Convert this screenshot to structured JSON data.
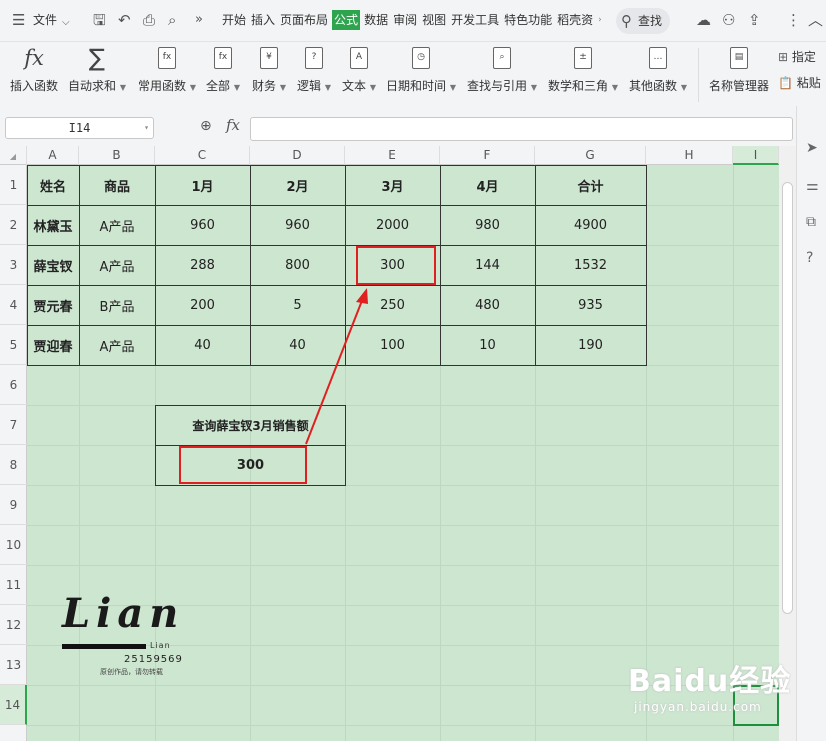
{
  "menubar": {
    "file_label": "文件",
    "tabs": [
      "开始",
      "插入",
      "页面布局",
      "公式",
      "数据",
      "审阅",
      "视图",
      "开发工具",
      "特色功能",
      "稻壳资"
    ],
    "active_tab": "公式",
    "search_label": "查找"
  },
  "ribbon": {
    "buttons": [
      "插入函数",
      "自动求和",
      "常用函数",
      "全部",
      "财务",
      "逻辑",
      "文本",
      "日期和时间",
      "查找与引用",
      "数学和三角",
      "其他函数",
      "名称管理器"
    ],
    "right": [
      "指定",
      "粘贴"
    ]
  },
  "formula_bar": {
    "name_box": "I14",
    "formula": ""
  },
  "columns": [
    "A",
    "B",
    "C",
    "D",
    "E",
    "F",
    "G",
    "H",
    "I"
  ],
  "rows": [
    "1",
    "2",
    "3",
    "4",
    "5",
    "6",
    "7",
    "8",
    "9",
    "10",
    "11",
    "12",
    "13",
    "14"
  ],
  "table": {
    "header": [
      "姓名",
      "商品",
      "1月",
      "2月",
      "3月",
      "4月",
      "合计"
    ],
    "rows": [
      [
        "林黛玉",
        "A产品",
        "960",
        "960",
        "2000",
        "980",
        "4900"
      ],
      [
        "薛宝钗",
        "A产品",
        "288",
        "800",
        "300",
        "144",
        "1532"
      ],
      [
        "贾元春",
        "B产品",
        "200",
        "5",
        "250",
        "480",
        "935"
      ],
      [
        "贾迎春",
        "A产品",
        "40",
        "40",
        "100",
        "10",
        "190"
      ]
    ]
  },
  "query": {
    "title": "查询薛宝钗3月销售额",
    "result": "300"
  },
  "logo": {
    "name": "Lian",
    "sub": "Lian",
    "number": "25159569",
    "caption": "原创作品，请勿转载"
  },
  "watermark": {
    "brand": "Baidu经验",
    "url": "jingyan.baidu.com"
  },
  "colors": {
    "grid_bg": "#cde6d0",
    "accent": "#2fa44e",
    "highlight": "#e02020"
  }
}
